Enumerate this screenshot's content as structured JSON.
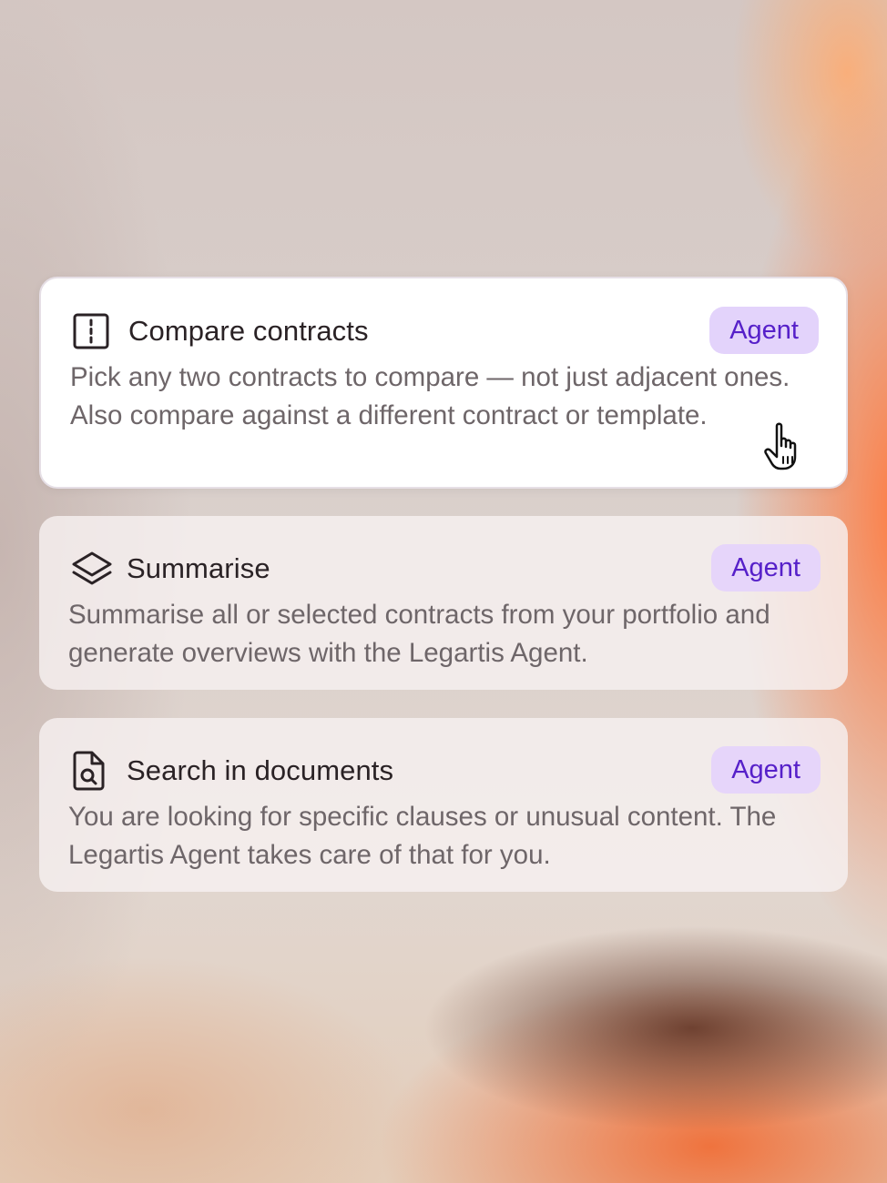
{
  "cards": [
    {
      "title": "Compare contracts",
      "badge": "Agent",
      "icon": "compare-icon",
      "description": "Pick any two contracts to compare — not just adjacent ones. Also compare against a different contract or template.",
      "state": "hovered"
    },
    {
      "title": "Summarise",
      "badge": "Agent",
      "icon": "layers-icon",
      "description": "Summarise all or selected contracts from your portfolio and generate overviews with the Legartis Agent.",
      "state": "default"
    },
    {
      "title": "Search in documents",
      "badge": "Agent",
      "icon": "document-search-icon",
      "description": "You are looking for specific clauses or unusual content. The Legartis Agent takes care of that for you.",
      "state": "default"
    }
  ],
  "colors": {
    "badge_bg": "#e3d3fb",
    "badge_text": "#5620c9",
    "title_text": "#2a2225",
    "body_text": "#6e6669",
    "accent_orange": "#ff7a3c"
  },
  "cursor": "hand-pointer-icon"
}
